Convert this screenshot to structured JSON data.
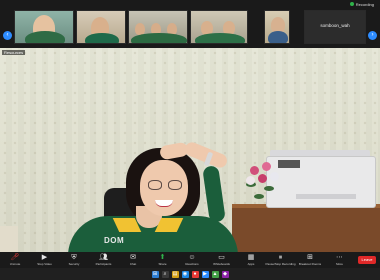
{
  "window": {
    "recording_label": "Recording",
    "recording_color": "#2fb34a"
  },
  "thumbnails": [
    {
      "name": "",
      "type": "video"
    },
    {
      "name": "",
      "type": "video"
    },
    {
      "name": "",
      "type": "video"
    },
    {
      "name": "",
      "type": "video"
    },
    {
      "name": "",
      "type": "video"
    },
    {
      "name": "",
      "type": "video"
    },
    {
      "name": "somboon_wah",
      "type": "name"
    }
  ],
  "navigation": {
    "prev_icon": "chevron-left-icon",
    "next_icon": "chevron-right-icon",
    "accent_color": "#2d8cff"
  },
  "main_video": {
    "top_left_label": "Resources",
    "bottom_left_label": "",
    "shirt_logo": "DOM"
  },
  "controls": {
    "items": [
      {
        "icon": "mic-icon",
        "label": "Unmute",
        "muted": true
      },
      {
        "icon": "video-icon",
        "label": "Stop Video",
        "muted": false
      },
      {
        "icon": "security-icon",
        "label": "Security",
        "muted": false
      },
      {
        "icon": "participants-icon",
        "label": "Participants",
        "count": "37"
      },
      {
        "icon": "chat-icon",
        "label": "Chat",
        "muted": false
      },
      {
        "icon": "share-icon",
        "label": "Share",
        "muted": false
      },
      {
        "icon": "reactions-icon",
        "label": "Reactions",
        "muted": false
      },
      {
        "icon": "whiteboard-icon",
        "label": "Whiteboards",
        "muted": false
      },
      {
        "icon": "apps-icon",
        "label": "Apps",
        "muted": false
      },
      {
        "icon": "record-icon",
        "label": "Pause/Stop Recording",
        "muted": false
      },
      {
        "icon": "breakout-icon",
        "label": "Breakout Rooms",
        "muted": false
      },
      {
        "icon": "more-icon",
        "label": "More",
        "muted": false
      }
    ],
    "leave_label": "Leave",
    "leave_color": "#e02828"
  },
  "taskbar": {
    "weather": "",
    "time": "",
    "date": ""
  }
}
